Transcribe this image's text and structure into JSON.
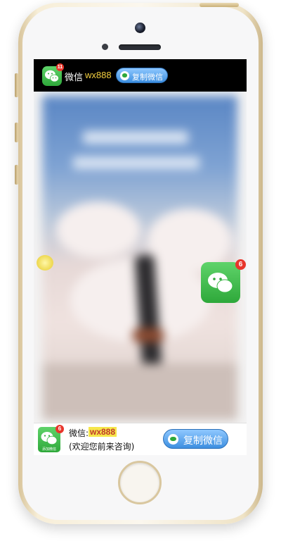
{
  "top_bar": {
    "wechat_label": "微信",
    "wechat_id": "wx888",
    "badge_count": "11",
    "copy_button_label": "复制微信"
  },
  "side_float": {
    "badge_count": "6"
  },
  "bottom_bar": {
    "wechat_label": "微信:",
    "wechat_id": "wx888",
    "welcome_text": "(欢迎您前来咨询)",
    "badge_count": "6",
    "copy_button_label": "复制微信",
    "icon_caption": "添加微信"
  },
  "colors": {
    "wechat_green": "#2ea83a",
    "copy_button_blue": "#3d8fe0",
    "badge_red": "#e8352b",
    "id_highlight_yellow": "#f6e64a"
  }
}
